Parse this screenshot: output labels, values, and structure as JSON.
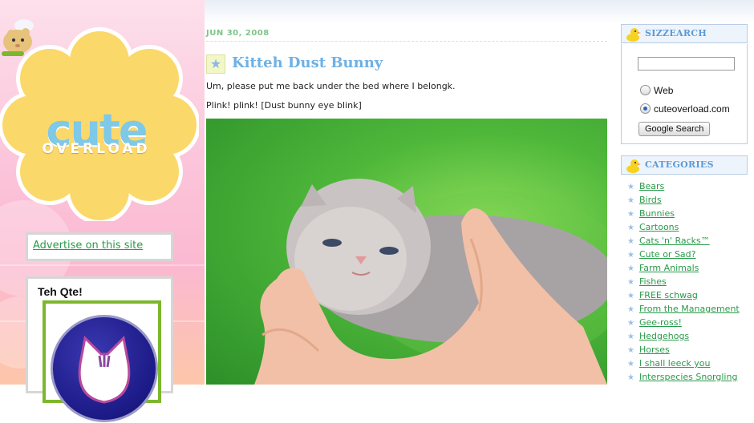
{
  "site": {
    "logo_main": "cute",
    "logo_sub": "OVERLOAD",
    "advertise_link": "Advertise on this site",
    "qte_title": "Teh Qte!"
  },
  "post": {
    "date": "JUN 30, 2008",
    "title": "Kitteh Dust Bunny",
    "paragraph1": "Um, please put me back under the bed where I belongk.",
    "paragraph2": "Plink! plink! [Dust bunny eye blink]",
    "star_icon": "★"
  },
  "search": {
    "heading": "SIZZEARCH",
    "query_value": "",
    "options": [
      "Web",
      "cuteoverload.com"
    ],
    "selected_option": "cuteoverload.com",
    "button_label": "Google Search"
  },
  "categories": {
    "heading": "CATEGORIES",
    "bullet": "★",
    "items": [
      "Bears",
      "Birds",
      "Bunnies",
      "Cartoons",
      "Cats 'n' Racks™",
      "Cute or Sad?",
      "Farm Animals",
      "Fishes",
      "FREE schwag",
      "From the Management",
      "Gee-ross!",
      "Hedgehogs",
      "Horses",
      "I shall leeck you",
      "Interspecies Snorgling"
    ]
  },
  "colors": {
    "link_green": "#2a9a4a",
    "title_blue": "#6fb1e4",
    "date_green": "#7cc48a",
    "logo_yellow": "#fbd86a",
    "qte_frame_green": "#7cb72c"
  },
  "icons": {
    "duck": "duck-icon",
    "hamster": "hamster-icon",
    "star": "star-icon"
  }
}
